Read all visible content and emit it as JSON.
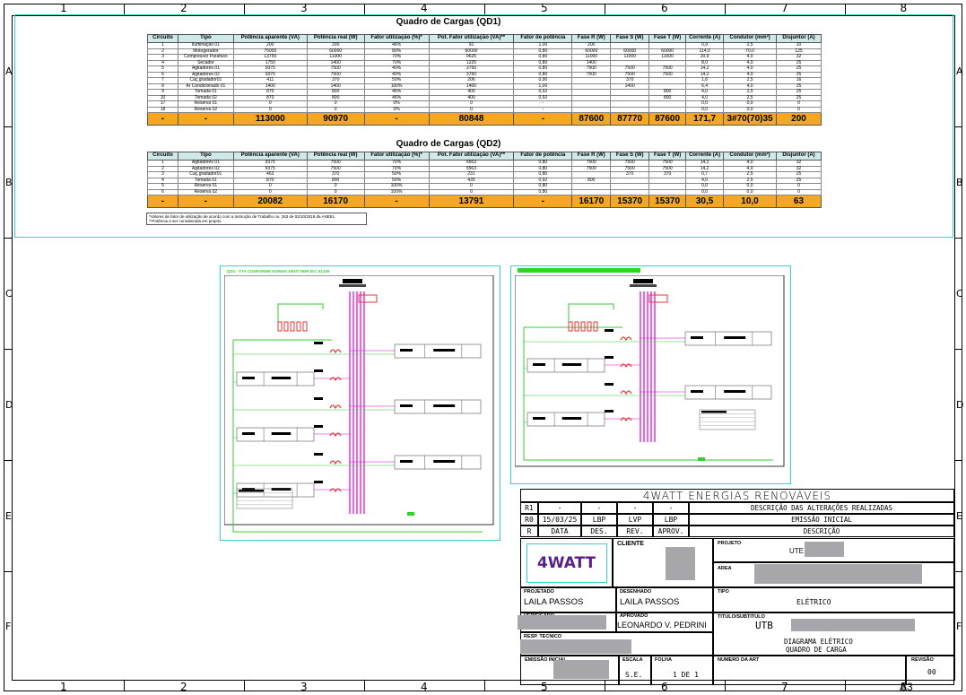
{
  "frame": {
    "columns": [
      "1",
      "2",
      "3",
      "4",
      "5",
      "6",
      "7",
      "8"
    ],
    "rows": [
      "A",
      "B",
      "C",
      "D",
      "E",
      "F"
    ],
    "sheet_size": "A3"
  },
  "qd1": {
    "title": "Quadro de Cargas (QD1)",
    "headers": [
      "Circuito",
      "Tipo",
      "Potência aparente (VA)",
      "Potência real (W)",
      "Fator utilização (%)*",
      "Pot. Fator utilização (VA)**",
      "Fator de potência",
      "Fase R (W)",
      "Fase S (W)",
      "Fase T (W)",
      "Corrente (A)",
      "Condutor (mm²)",
      "Disjuntor (A)"
    ],
    "rows": [
      [
        "1",
        "Iluminação 01",
        "200",
        "200",
        "46%",
        "92",
        "1,00",
        "200",
        "",
        "",
        "0,9",
        "2,5",
        "10"
      ],
      [
        "2",
        "Motogerador",
        "75000",
        "60000",
        "80%",
        "60000",
        "0,80",
        "60000",
        "60000",
        "60000",
        "114,0",
        "70,0",
        "125"
      ],
      [
        "3",
        "Compressor Parafuso",
        "13750",
        "11000",
        "70%",
        "9625",
        "0,80",
        "11000",
        "11000",
        "11000",
        "20,9",
        "4,0",
        "32"
      ],
      [
        "4",
        "Secador",
        "1750",
        "1400",
        "70%",
        "1225",
        "0,80",
        "1400",
        "",
        "",
        "8,0",
        "4,0",
        "25"
      ],
      [
        "5",
        "Agitadores 01",
        "9375",
        "7500",
        "40%",
        "3750",
        "0,80",
        "7500",
        "7500",
        "7500",
        "14,2",
        "4,0",
        "25"
      ],
      [
        "6",
        "Agitadores 02",
        "9375",
        "7500",
        "40%",
        "3750",
        "0,80",
        "7500",
        "7500",
        "7500",
        "14,2",
        "4,0",
        "25"
      ],
      [
        "7",
        "Caç.gradador01",
        "411",
        "370",
        "50%",
        "206",
        "0,90",
        "",
        "370",
        "",
        "1,6",
        "2,5",
        "16"
      ],
      [
        "8",
        "Ar Condicionado 01",
        "1400",
        "1400",
        "100%",
        "1400",
        "1,00",
        "",
        "1400",
        "",
        "6,4",
        "4,0",
        "25"
      ],
      [
        "9",
        "Tomada 01",
        "870",
        "800",
        "46%",
        "400",
        "0,92",
        "",
        "",
        "800",
        "4,0",
        "2,5",
        "25"
      ],
      [
        "10",
        "Tomada 02",
        "870",
        "800",
        "46%",
        "400",
        "0,92",
        "",
        "",
        "800",
        "4,0",
        "2,5",
        "25"
      ],
      [
        "17",
        "Reserva 01",
        "0",
        "0",
        "0%",
        "0",
        "-",
        "",
        "",
        "",
        "0,0",
        "0,0",
        "0"
      ],
      [
        "18",
        "Reserva 02",
        "0",
        "0",
        "0%",
        "0",
        "-",
        "",
        "",
        "",
        "0,0",
        "0,0",
        "0"
      ]
    ],
    "total": [
      "-",
      "-",
      "113000",
      "90970",
      "-",
      "80848",
      "-",
      "87600",
      "87770",
      "87600",
      "171,7",
      "3#70(70)35",
      "200"
    ]
  },
  "qd2": {
    "title": "Quadro de Cargas (QD2)",
    "headers": [
      "Circuito",
      "Tipo",
      "Potência aparente (VA)",
      "Potência real (W)",
      "Fator utilização (%)*",
      "Pot. Fator utilização (VA)**",
      "Fator de potência",
      "Fase R (W)",
      "Fase S (W)",
      "Fase T (W)",
      "Corrente (A)",
      "Condutor (mm²)",
      "Disjuntor (A)"
    ],
    "rows": [
      [
        "1",
        "Agitadores 01",
        "9375",
        "7500",
        "70%",
        "6563",
        "0,80",
        "7500",
        "7500",
        "7500",
        "14,2",
        "4,0",
        "32"
      ],
      [
        "2",
        "Agitadores 02",
        "9375",
        "7500",
        "70%",
        "6563",
        "0,80",
        "7500",
        "7500",
        "7500",
        "14,2",
        "4,0",
        "32"
      ],
      [
        "3",
        "Caç.gradador01",
        "463",
        "370",
        "50%",
        "231",
        "0,80",
        "",
        "370",
        "370",
        "0,7",
        "2,5",
        "25"
      ],
      [
        "4",
        "Tomada 01",
        "870",
        "800",
        "50%",
        "435",
        "0,92",
        "800",
        "",
        "",
        "4,0",
        "2,5",
        "25"
      ],
      [
        "5",
        "Reserva 01",
        "0",
        "0",
        "100%",
        "0",
        "0,80",
        "",
        "",
        "",
        "0,0",
        "0,0",
        "0"
      ],
      [
        "6",
        "Reserva 02",
        "0",
        "0",
        "100%",
        "0",
        "0,80",
        "",
        "",
        "",
        "0,0",
        "0,0",
        "0"
      ]
    ],
    "total": [
      "-",
      "-",
      "20082",
      "16170",
      "-",
      "13791",
      "-",
      "16170",
      "15370",
      "15370",
      "30,5",
      "10,0",
      "63"
    ],
    "notes": [
      "*Valores de fator de utilização de acordo com a Instrução de Trabalho no. 263 de 02/10/2018 da ANEEL",
      "**Potência a ser considerada em projeto"
    ]
  },
  "diagram1": {
    "caption": "QD1 - TTA CONFORME NORMA ABNT NBR IEC 61439"
  },
  "titleblock": {
    "company": "4WATT ENERGIAS RENOVÁVEIS",
    "rev_rows": [
      [
        "R1",
        "-",
        "-",
        "-",
        "-",
        "DESCRIÇÃO DAS ALTERAÇÕES REALIZADAS"
      ],
      [
        "R0",
        "15/03/25",
        "LBP",
        "LVP",
        "LBP",
        "EMISSÃO INICIAL"
      ],
      [
        "R",
        "DATA",
        "DES.",
        "REV.",
        "APROV.",
        "DESCRIÇÃO"
      ]
    ],
    "logo": "4WATT",
    "cliente_label": "CLIENTE",
    "projeto_label": "PROJETO",
    "projeto_value": "UTE",
    "area_label": "AREA",
    "projetado_label": "PROJETADO",
    "projetado_value": "LAILA PASSOS",
    "desenhado_label": "DESENHADO",
    "desenhado_value": "LAILA PASSOS",
    "tipo_label": "TIPO",
    "tipo_value": "ELÉTRICO",
    "verificado_label": "VERIFICADO",
    "aprovado_label": "APROVADO",
    "aprovado_value": "LEONARDO V. PEDRINI",
    "titulo_label": "TITULO/SUBTITULO",
    "titulo_prefix": "UTB",
    "titulo_line1": "DIAGRAMA ELÉTRICO",
    "titulo_line2": "QUADRO DE CARGA",
    "resp_label": "RESP. TECNICO",
    "emissao_label": "EMISSÃO INICIAL",
    "escala_label": "ESCALA",
    "escala_value": "S.E.",
    "folha_label": "FOLHA",
    "folha_value": "1 DE 1",
    "numero_label": "NUMERO DA ART",
    "revisao_label": "REVISÃO",
    "revisao_value": "00"
  }
}
